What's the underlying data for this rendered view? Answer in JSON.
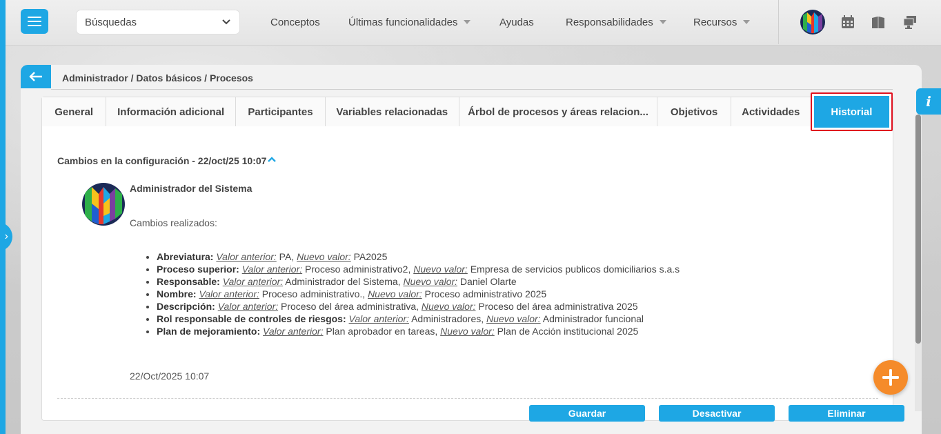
{
  "topbar": {
    "search_select": "Búsquedas",
    "nav": [
      {
        "label": "Conceptos",
        "dropdown": false
      },
      {
        "label": "Últimas funcionalidades",
        "dropdown": true
      },
      {
        "label": "Ayudas",
        "dropdown": false
      },
      {
        "label": "Responsabilidades",
        "dropdown": true
      },
      {
        "label": "Recursos",
        "dropdown": true
      }
    ],
    "icons": [
      "calendar-icon",
      "book-icon",
      "monitor-icon"
    ]
  },
  "breadcrumb": "Administrador / Datos básicos / Procesos",
  "tabs": [
    {
      "label": "General"
    },
    {
      "label": "Información adicional"
    },
    {
      "label": "Participantes"
    },
    {
      "label": "Variables relacionadas"
    },
    {
      "label": "Árbol de procesos y áreas relacion..."
    },
    {
      "label": "Objetivos"
    },
    {
      "label": "Actividades"
    },
    {
      "label": "Historial",
      "active": true
    }
  ],
  "history": {
    "title": "Cambios en la configuración - 22/oct/25 10:07",
    "user": "Administrador del Sistema",
    "changes_label": "Cambios realizados:",
    "prev_label": "Valor anterior:",
    "new_label": "Nuevo valor:",
    "changes": [
      {
        "field": "Abreviatura:",
        "prev": "PA",
        "new": "PA2025"
      },
      {
        "field": "Proceso superior:",
        "prev": "Proceso administrativo2",
        "new": "Empresa de servicios publicos domiciliarios s.a.s"
      },
      {
        "field": "Responsable:",
        "prev": "Administrador del Sistema",
        "new": "Daniel Olarte"
      },
      {
        "field": "Nombre:",
        "prev": "Proceso administrativo.",
        "new": "Proceso administrativo 2025"
      },
      {
        "field": "Descripción:",
        "prev": "Proceso del área administrativa",
        "new": "Proceso del área administrativa 2025"
      },
      {
        "field": "Rol responsable de controles de riesgos:",
        "prev": "Administradores",
        "new": "Administrador funcional"
      },
      {
        "field": "Plan de mejoramiento:",
        "prev": "Plan aprobador en tareas",
        "new": "Plan de Acción institucional 2025"
      }
    ],
    "date": "22/Oct/2025 10:07"
  },
  "buttons": {
    "save": "Guardar",
    "deactivate": "Desactivar",
    "delete": "Eliminar"
  },
  "info_tab": "i",
  "colors": {
    "accent": "#1ea7e4",
    "fab": "#f58b2a",
    "highlight": "#e0101e"
  }
}
